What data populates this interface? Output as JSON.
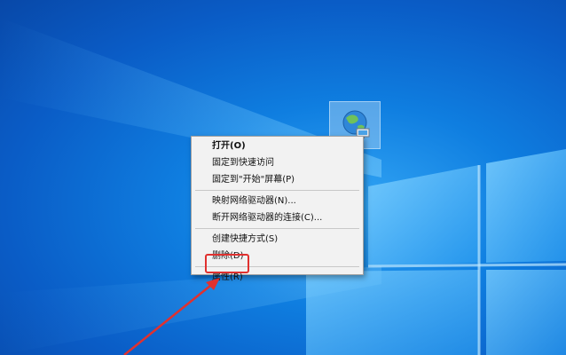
{
  "desktop": {
    "icon": {
      "name": "network-globe-icon"
    }
  },
  "context_menu": {
    "items": [
      {
        "label": "打开(O)",
        "bold": true
      },
      {
        "label": "固定到快速访问"
      },
      {
        "label": "固定到\"开始\"屏幕(P)"
      },
      {
        "label": "映射网络驱动器(N)..."
      },
      {
        "label": "断开网络驱动器的连接(C)..."
      },
      {
        "label": "创建快捷方式(S)"
      },
      {
        "label": "删除(D)"
      },
      {
        "label": "属性(R)"
      }
    ]
  },
  "annotation": {
    "highlight_color": "#e0312f",
    "target": "属性(R)"
  },
  "colors": {
    "wallpaper_blue": "#0f7ee0",
    "menu_background": "#f2f2f2"
  }
}
